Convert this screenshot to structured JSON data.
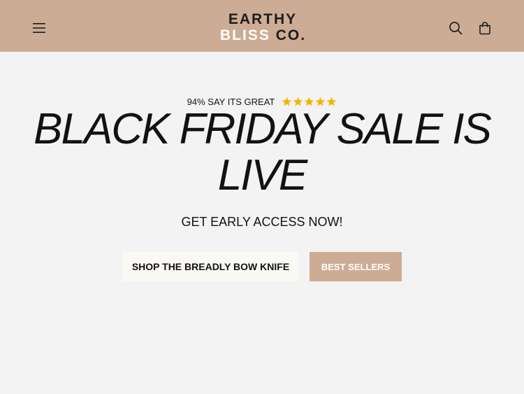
{
  "header": {
    "logo_line1": "EARTHY",
    "logo_line2_part1": "BLISS",
    "logo_line2_part2": "CO.",
    "background": "#cdac95"
  },
  "icons": {
    "menu": "hamburger-menu-icon",
    "search": "search-icon",
    "cart": "cart-icon",
    "star": "star-icon"
  },
  "hero": {
    "rating_text": "94% SAY ITS GREAT",
    "rating_stars": 5,
    "star_color": "#f4b400",
    "headline": "BLACK FRIDAY SALE IS LIVE",
    "subhead": "GET EARLY ACCESS NOW!",
    "primary_button": "SHOP THE BREADLY BOW KNIFE",
    "secondary_button": "BEST SELLERS"
  }
}
